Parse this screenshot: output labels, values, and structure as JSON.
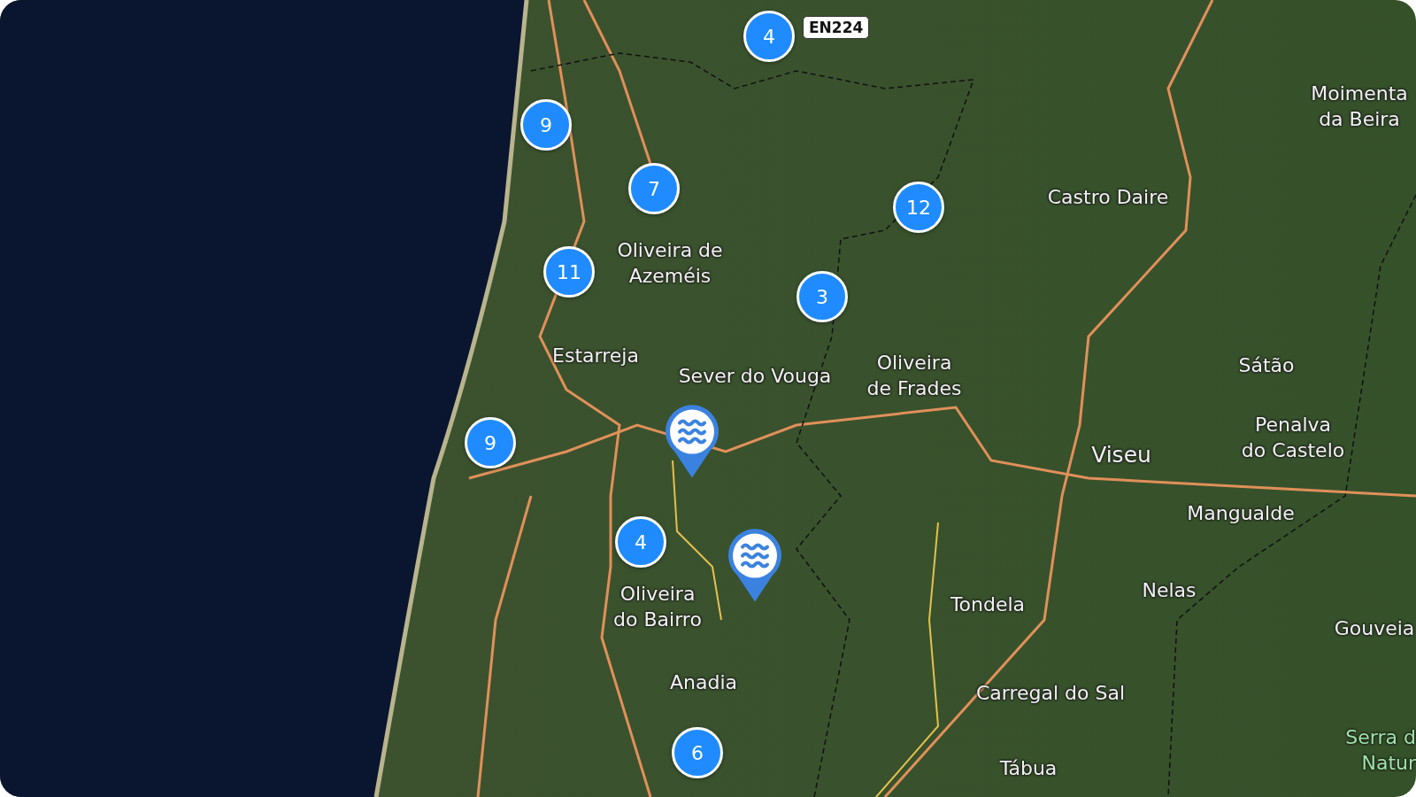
{
  "map": {
    "road_badge": "EN224",
    "clusters": [
      {
        "count": "4"
      },
      {
        "count": "9"
      },
      {
        "count": "7"
      },
      {
        "count": "12"
      },
      {
        "count": "11"
      },
      {
        "count": "3"
      },
      {
        "count": "9"
      },
      {
        "count": "4"
      },
      {
        "count": "6"
      }
    ],
    "pins": [
      {
        "kind": "water"
      },
      {
        "kind": "water"
      }
    ],
    "places": [
      {
        "name": "Moimenta\nda Beira",
        "kind": "town"
      },
      {
        "name": "Castro Daire",
        "kind": "town"
      },
      {
        "name": "Oliveira de\nAzeméis",
        "kind": "town"
      },
      {
        "name": "Estarreja",
        "kind": "town"
      },
      {
        "name": "Sever do Vouga",
        "kind": "town"
      },
      {
        "name": "Oliveira\nde Frades",
        "kind": "town"
      },
      {
        "name": "Sátão",
        "kind": "town"
      },
      {
        "name": "Viseu",
        "kind": "city"
      },
      {
        "name": "Penalva\ndo Castelo",
        "kind": "town"
      },
      {
        "name": "Mangualde",
        "kind": "town"
      },
      {
        "name": "Nelas",
        "kind": "town"
      },
      {
        "name": "Oliveira\ndo Bairro",
        "kind": "town"
      },
      {
        "name": "Tondela",
        "kind": "town"
      },
      {
        "name": "Gouveia",
        "kind": "town"
      },
      {
        "name": "Anadia",
        "kind": "town"
      },
      {
        "name": "Carregal do Sal",
        "kind": "town"
      },
      {
        "name": "Tábua",
        "kind": "town"
      },
      {
        "name": "Serra d\nNatur",
        "kind": "park"
      }
    ]
  }
}
